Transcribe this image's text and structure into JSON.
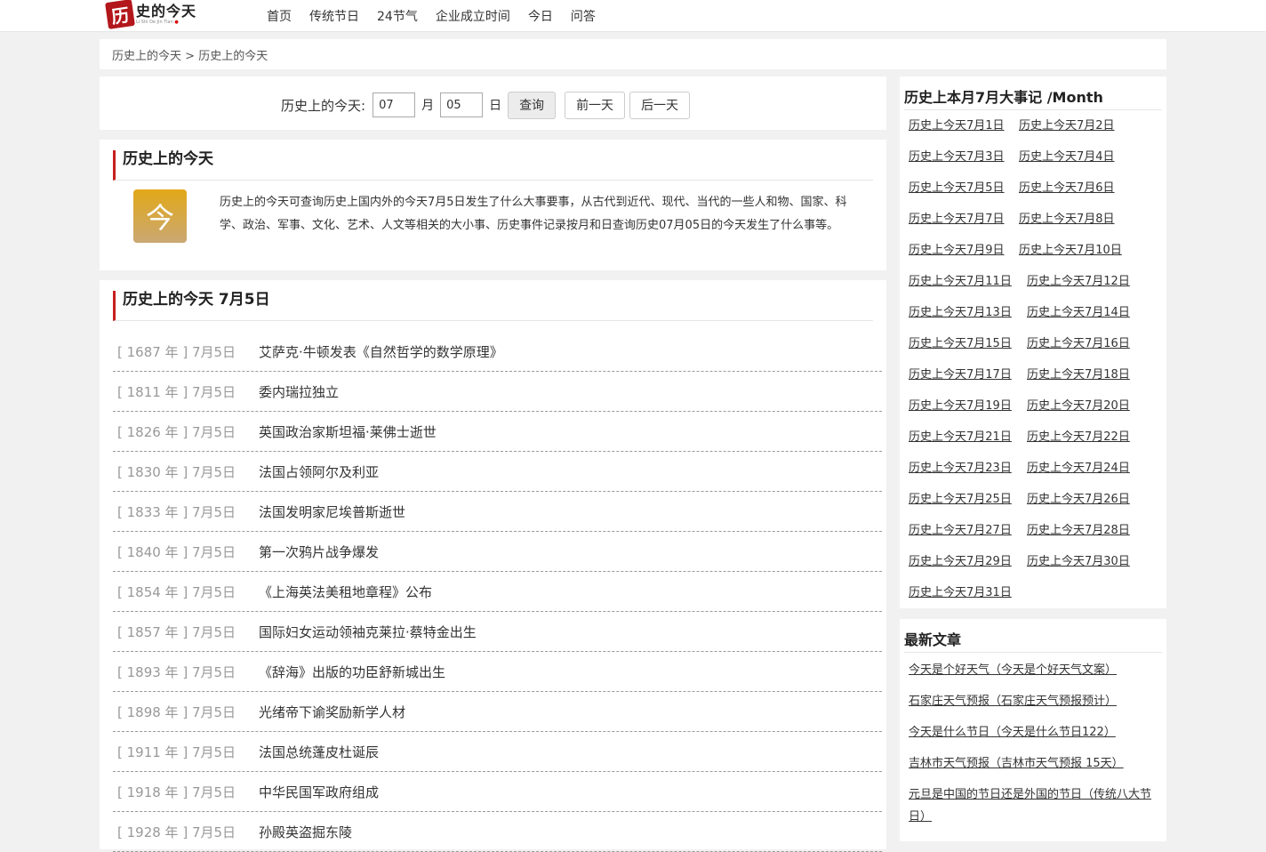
{
  "logo": {
    "mark": "历",
    "title": "史的今天",
    "pinyin": "Li Shi De Jin Tian"
  },
  "nav": [
    "首页",
    "传统节日",
    "24节气",
    "企业成立时间",
    "今日",
    "问答"
  ],
  "breadcrumb": {
    "home": "历史上的今天",
    "sep": ">",
    "current": "历史上的今天"
  },
  "query": {
    "label": "历史上的今天:",
    "month_value": "07",
    "month_unit": "月",
    "day_value": "05",
    "day_unit": "日",
    "search_label": "查询",
    "prev_label": "前一天",
    "next_label": "后一天"
  },
  "intro": {
    "title": "历史上的今天",
    "icon_char": "今",
    "text": "历史上的今天可查询历史上国内外的今天7月5日发生了什么大事要事，从古代到近代、现代、当代的一些人和物、国家、科学、政治、军事、文化、艺术、人文等相关的大小事、历史事件记录按月和日查询历史07月05日的今天发生了什么事等。"
  },
  "events": {
    "title": "历史上的今天 7月5日",
    "items": [
      {
        "date": "[ 1687 年 ] 7月5日",
        "title": "艾萨克·牛顿发表《自然哲学的数学原理》"
      },
      {
        "date": "[ 1811 年 ] 7月5日",
        "title": "委内瑞拉独立"
      },
      {
        "date": "[ 1826 年 ] 7月5日",
        "title": "英国政治家斯坦福·莱佛士逝世"
      },
      {
        "date": "[ 1830 年 ] 7月5日",
        "title": "法国占领阿尔及利亚"
      },
      {
        "date": "[ 1833 年 ] 7月5日",
        "title": "法国发明家尼埃普斯逝世"
      },
      {
        "date": "[ 1840 年 ] 7月5日",
        "title": "第一次鸦片战争爆发"
      },
      {
        "date": "[ 1854 年 ] 7月5日",
        "title": "《上海英法美租地章程》公布"
      },
      {
        "date": "[ 1857 年 ] 7月5日",
        "title": "国际妇女运动领袖克莱拉·蔡特金出生"
      },
      {
        "date": "[ 1893 年 ] 7月5日",
        "title": "《辞海》出版的功臣舒新城出生"
      },
      {
        "date": "[ 1898 年 ] 7月5日",
        "title": "光绪帝下谕奖励新学人材"
      },
      {
        "date": "[ 1911 年 ] 7月5日",
        "title": "法国总统蓬皮杜诞辰"
      },
      {
        "date": "[ 1918 年 ] 7月5日",
        "title": "中华民国军政府组成"
      },
      {
        "date": "[ 1928 年 ] 7月5日",
        "title": "孙殿英盗掘东陵"
      }
    ]
  },
  "sidebar": {
    "month_title": "历史上本月7月大事记 /Month",
    "month_links": [
      "历史上今天7月1日",
      "历史上今天7月2日",
      "历史上今天7月3日",
      "历史上今天7月4日",
      "历史上今天7月5日",
      "历史上今天7月6日",
      "历史上今天7月7日",
      "历史上今天7月8日",
      "历史上今天7月9日",
      "历史上今天7月10日",
      "历史上今天7月11日",
      "历史上今天7月12日",
      "历史上今天7月13日",
      "历史上今天7月14日",
      "历史上今天7月15日",
      "历史上今天7月16日",
      "历史上今天7月17日",
      "历史上今天7月18日",
      "历史上今天7月19日",
      "历史上今天7月20日",
      "历史上今天7月21日",
      "历史上今天7月22日",
      "历史上今天7月23日",
      "历史上今天7月24日",
      "历史上今天7月25日",
      "历史上今天7月26日",
      "历史上今天7月27日",
      "历史上今天7月28日",
      "历史上今天7月29日",
      "历史上今天7月30日",
      "历史上今天7月31日"
    ],
    "news_title": "最新文章",
    "news_links": [
      "今天是个好天气（今天是个好天气文案）",
      "石家庄天气预报（石家庄天气预报预计）",
      "今天是什么节日（今天是什么节日122）",
      "吉林市天气预报（吉林市天气预报 15天）",
      "元旦是中国的节日还是外国的节日（传统八大节日）"
    ]
  }
}
